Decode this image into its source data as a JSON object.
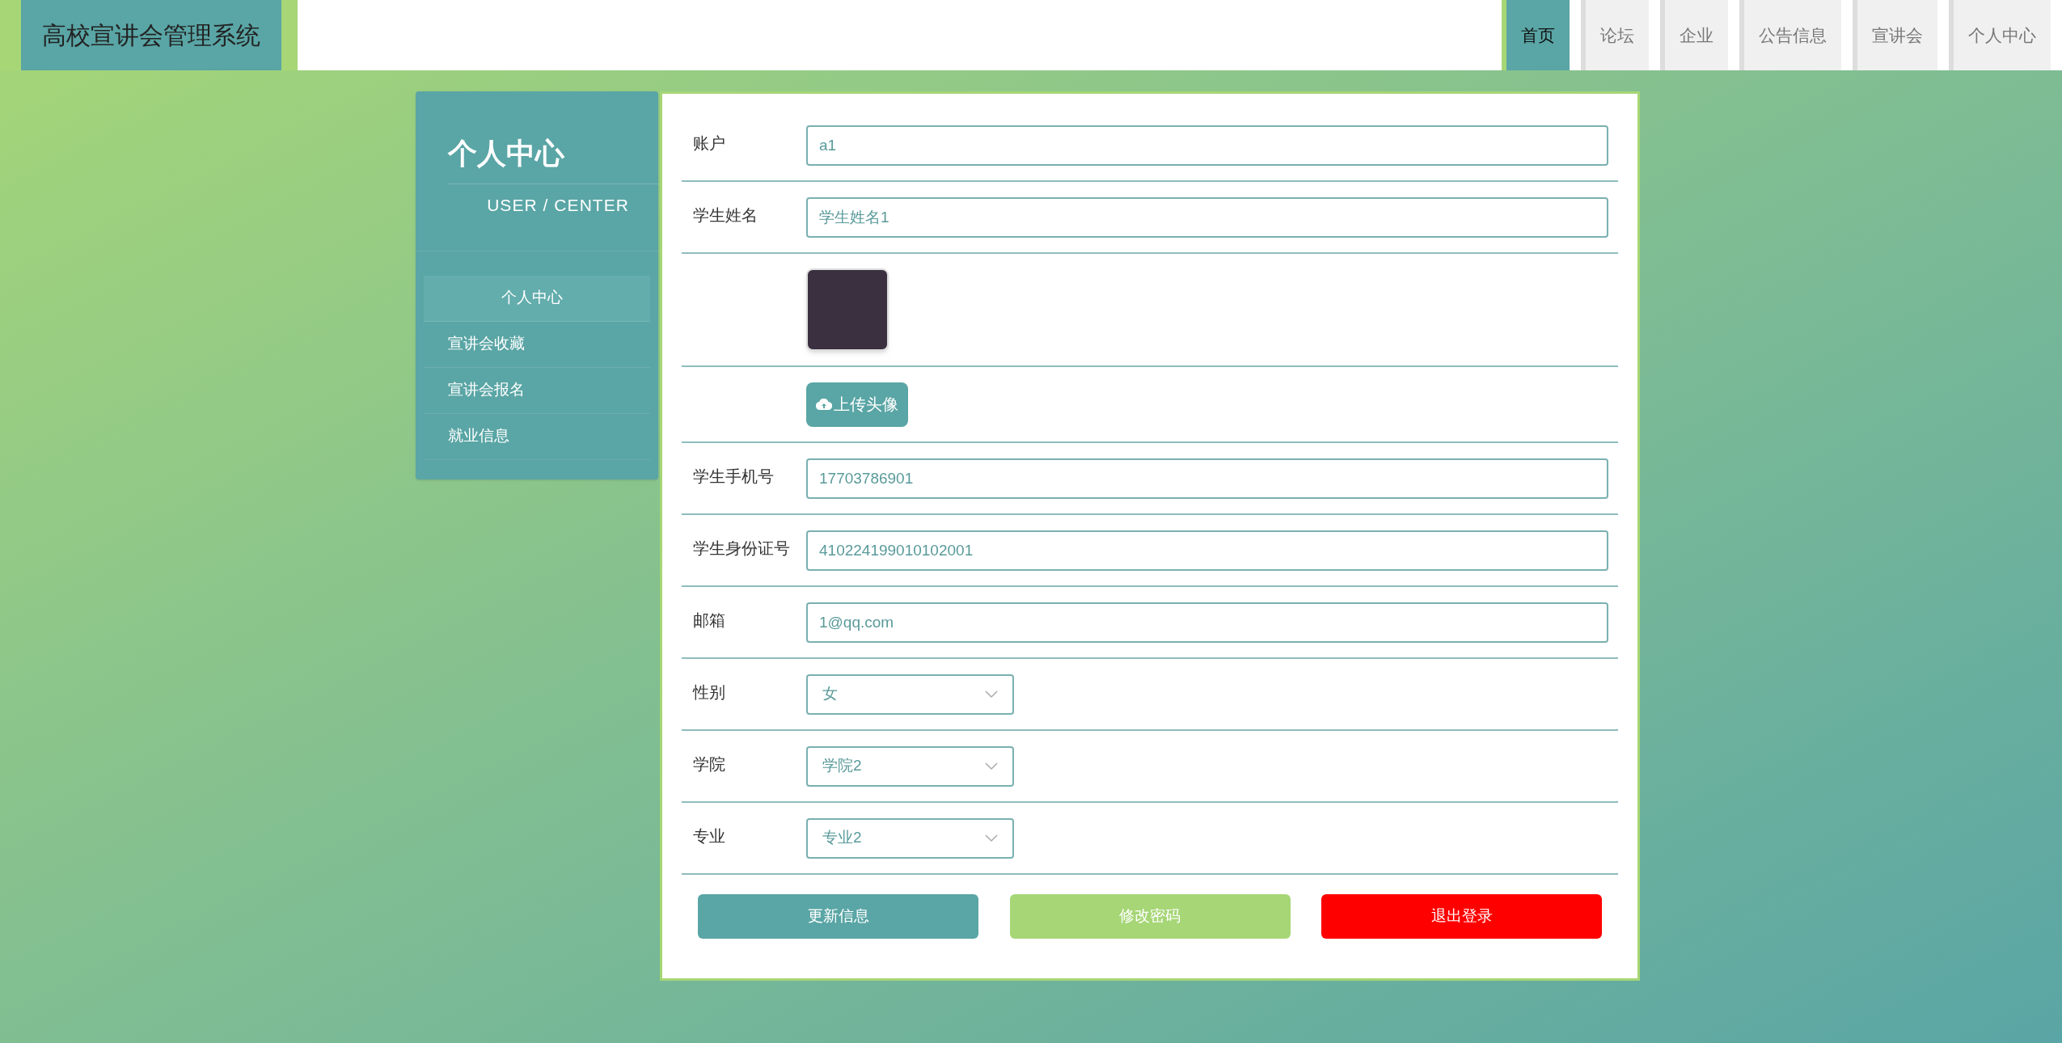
{
  "header": {
    "title": "高校宣讲会管理系统",
    "nav": [
      {
        "label": "首页",
        "selected": true
      },
      {
        "label": "论坛",
        "selected": false
      },
      {
        "label": "企业",
        "selected": false
      },
      {
        "label": "公告信息",
        "selected": false
      },
      {
        "label": "宣讲会",
        "selected": false
      },
      {
        "label": "个人中心",
        "selected": false
      }
    ]
  },
  "sidebar": {
    "title": "个人中心",
    "subtitle": "USER / CENTER",
    "items": [
      {
        "label": "个人中心",
        "selected": true
      },
      {
        "label": "宣讲会收藏",
        "selected": false
      },
      {
        "label": "宣讲会报名",
        "selected": false
      },
      {
        "label": "就业信息",
        "selected": false
      }
    ]
  },
  "form": {
    "rows": [
      {
        "kind": "input",
        "label": "账户",
        "value": "a1"
      },
      {
        "kind": "input",
        "label": "学生姓名",
        "value": "学生姓名1"
      },
      {
        "kind": "avatar"
      },
      {
        "kind": "upload",
        "button": "上传头像"
      },
      {
        "kind": "input",
        "label": "学生手机号",
        "value": "17703786901"
      },
      {
        "kind": "input",
        "label": "学生身份证号",
        "value": "410224199010102001"
      },
      {
        "kind": "input",
        "label": "邮箱",
        "value": "1@qq.com"
      },
      {
        "kind": "select",
        "label": "性别",
        "value": "女"
      },
      {
        "kind": "select",
        "label": "学院",
        "value": "学院2"
      },
      {
        "kind": "select",
        "label": "专业",
        "value": "专业2"
      }
    ],
    "buttons": [
      {
        "label": "更新信息",
        "color": "#5aa5a5"
      },
      {
        "label": "修改密码",
        "color": "#a6d676"
      },
      {
        "label": "退出登录",
        "color": "#ff0000"
      }
    ]
  }
}
